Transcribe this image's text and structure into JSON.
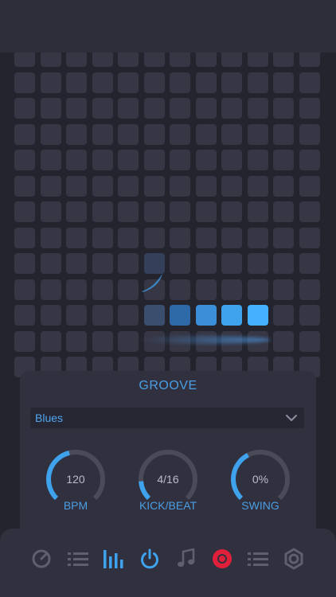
{
  "grid": {
    "rows": 13,
    "cols": 12,
    "active": [
      {
        "row": 10,
        "col": 5,
        "level": 1
      },
      {
        "row": 10,
        "col": 6,
        "level": 2
      },
      {
        "row": 10,
        "col": 7,
        "level": 3
      },
      {
        "row": 10,
        "col": 8,
        "level": 4
      },
      {
        "row": 10,
        "col": 9,
        "level": 5
      }
    ],
    "flicker": [
      {
        "row": 8,
        "col": 5
      }
    ]
  },
  "groove": {
    "title": "GROOVE",
    "style_value": "Blues",
    "knobs": [
      {
        "value": "120",
        "label": "BPM",
        "fraction": 0.45
      },
      {
        "value": "4/16",
        "label": "KICK/BEAT",
        "fraction": 0.15
      },
      {
        "value": "0%",
        "label": "SWING",
        "fraction": 0.4
      }
    ]
  },
  "nav": {
    "items": [
      {
        "icon": "gauge-icon",
        "active": false
      },
      {
        "icon": "list-icon",
        "active": false
      },
      {
        "icon": "equalizer-icon",
        "active": true
      },
      {
        "icon": "power-icon",
        "active": true
      },
      {
        "icon": "music-note-icon",
        "active": false
      },
      {
        "icon": "record-icon",
        "active": true
      },
      {
        "icon": "list-icon",
        "active": false
      },
      {
        "icon": "settings-gear-icon",
        "active": false
      }
    ]
  },
  "colors": {
    "accent": "#3ea2ec",
    "record": "#e0203a",
    "inactive_icon": "#5e6070"
  }
}
